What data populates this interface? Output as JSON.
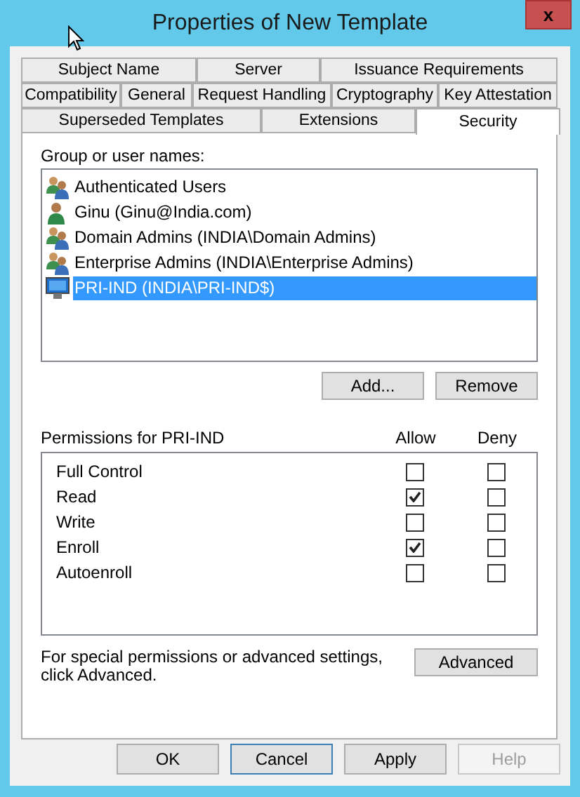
{
  "window": {
    "title": "Properties of New Template",
    "close": "x"
  },
  "tab_rows": [
    [
      {
        "label": "Subject Name",
        "selected": false
      },
      {
        "label": "Server",
        "selected": false
      },
      {
        "label": "Issuance Requirements",
        "selected": false
      }
    ],
    [
      {
        "label": "Compatibility",
        "selected": false
      },
      {
        "label": "General",
        "selected": false
      },
      {
        "label": "Request Handling",
        "selected": false
      },
      {
        "label": "Cryptography",
        "selected": false
      },
      {
        "label": "Key Attestation",
        "selected": false
      }
    ],
    [
      {
        "label": "Superseded Templates",
        "selected": false
      },
      {
        "label": "Extensions",
        "selected": false
      },
      {
        "label": "Security",
        "selected": true
      }
    ]
  ],
  "group_label": "Group or user names:",
  "principals": [
    {
      "name": "Authenticated Users",
      "kind": "group",
      "selected": false
    },
    {
      "name": "Ginu (Ginu@India.com)",
      "kind": "user",
      "selected": false
    },
    {
      "name": "Domain Admins (INDIA\\Domain Admins)",
      "kind": "group",
      "selected": false
    },
    {
      "name": "Enterprise Admins (INDIA\\Enterprise Admins)",
      "kind": "group",
      "selected": false
    },
    {
      "name": "PRI-IND (INDIA\\PRI-IND$)",
      "kind": "computer",
      "selected": true
    }
  ],
  "list_buttons": [
    {
      "label": "Add...",
      "disabled": false
    },
    {
      "label": "Remove",
      "disabled": false
    }
  ],
  "permissions": {
    "title": "Permissions for PRI-IND",
    "allow_header": "Allow",
    "deny_header": "Deny",
    "rows": [
      {
        "name": "Full Control",
        "allow": false,
        "deny": false
      },
      {
        "name": "Read",
        "allow": true,
        "deny": false
      },
      {
        "name": "Write",
        "allow": false,
        "deny": false
      },
      {
        "name": "Enroll",
        "allow": true,
        "deny": false
      },
      {
        "name": "Autoenroll",
        "allow": false,
        "deny": false
      }
    ]
  },
  "advanced_note": "For special permissions or advanced settings, click Advanced.",
  "advanced_button": "Advanced",
  "buttons": [
    {
      "label": "OK",
      "disabled": false,
      "focused": false
    },
    {
      "label": "Cancel",
      "disabled": false,
      "focused": true
    },
    {
      "label": "Apply",
      "disabled": false,
      "focused": false
    },
    {
      "label": "Help",
      "disabled": true,
      "focused": false
    }
  ]
}
